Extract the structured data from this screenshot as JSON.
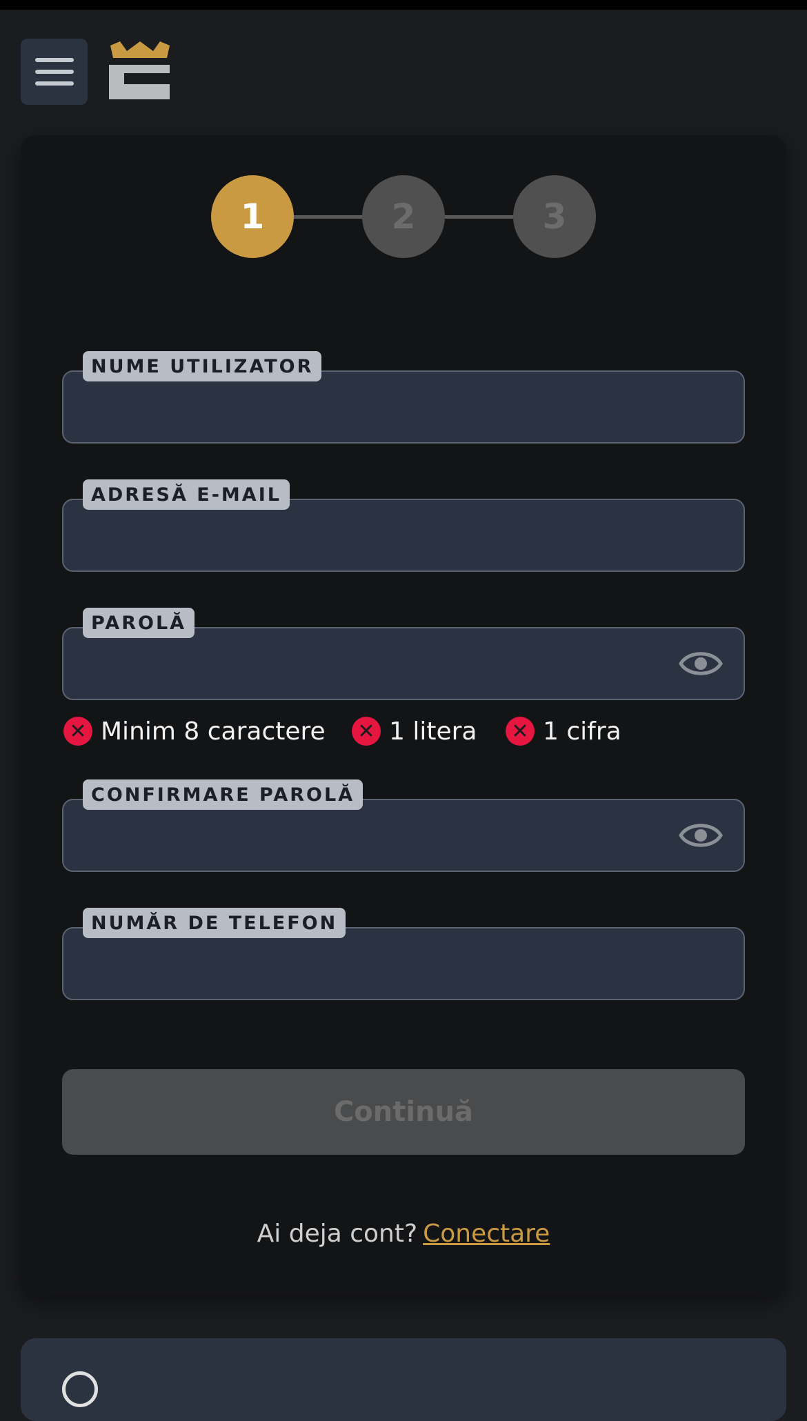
{
  "header": {
    "menu_icon": "hamburger-menu-icon",
    "logo_icon": "crown-logo-icon",
    "colors": {
      "logo_gold": "#c99a42",
      "logo_silver": "#b9bcbf"
    }
  },
  "stepper": {
    "steps": [
      {
        "label": "1",
        "state": "active"
      },
      {
        "label": "2",
        "state": "inactive"
      },
      {
        "label": "3",
        "state": "inactive"
      }
    ],
    "colors": {
      "active": "#c99a42",
      "inactive": "#505050"
    }
  },
  "form": {
    "username": {
      "label": "NUME UTILIZATOR",
      "value": ""
    },
    "email": {
      "label": "ADRESĂ E-MAIL",
      "value": ""
    },
    "password": {
      "label": "PAROLĂ",
      "value": "",
      "toggle_icon": "eye-icon"
    },
    "password_rules": [
      {
        "text": "Minim 8 caractere",
        "status": "invalid",
        "icon": "x-circle-icon"
      },
      {
        "text": "1 litera",
        "status": "invalid",
        "icon": "x-circle-icon"
      },
      {
        "text": "1 cifra",
        "status": "invalid",
        "icon": "x-circle-icon"
      }
    ],
    "confirm_password": {
      "label": "CONFIRMARE PAROLĂ",
      "value": "",
      "toggle_icon": "eye-icon"
    },
    "phone": {
      "label": "NUMĂR DE TELEFON",
      "value": ""
    },
    "continue_label": "Continuă",
    "continue_state": "disabled"
  },
  "login": {
    "prompt": "Ai deja cont?",
    "link_label": "Conectare"
  },
  "colors": {
    "accent": "#c99a42",
    "error": "#e5163f",
    "background": "#1b1c1f",
    "card": "#131416",
    "input": "#2b3241"
  }
}
